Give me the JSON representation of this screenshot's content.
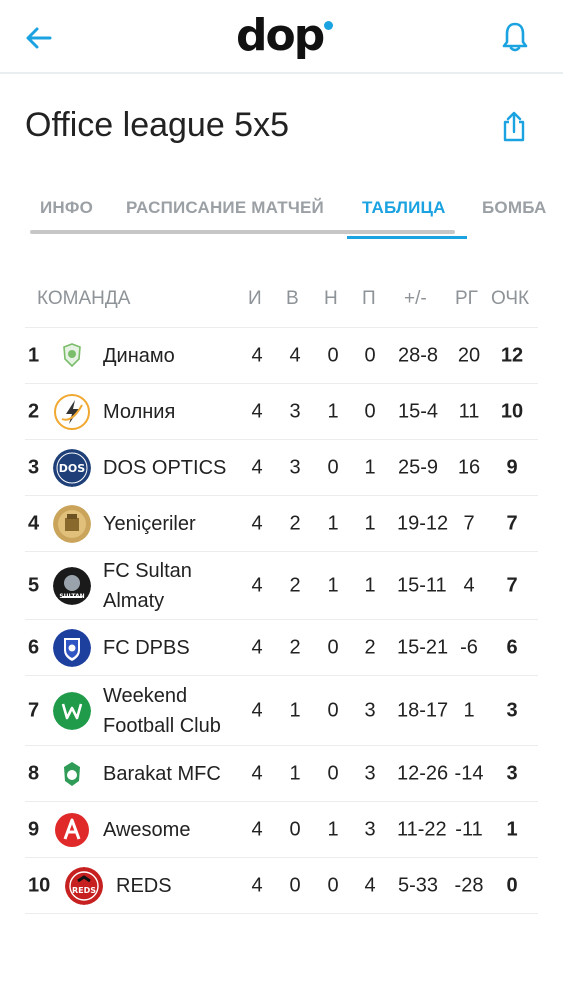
{
  "app": {
    "logo_text": "dop"
  },
  "page": {
    "title": "Office league 5x5"
  },
  "tabs": [
    {
      "label": "ИНФО",
      "active": false
    },
    {
      "label": "РАСПИСАНИЕ МАТЧЕЙ",
      "active": false
    },
    {
      "label": "ТАБЛИЦА",
      "active": true
    },
    {
      "label": "БОМБА",
      "active": false
    }
  ],
  "table": {
    "headers": {
      "team": "КОМАНДА",
      "played": "И",
      "won": "В",
      "draw": "Н",
      "lost": "П",
      "goals": "+/-",
      "diff": "РГ",
      "points": "ОЧК"
    },
    "rows": [
      {
        "pos": "1",
        "team": "Динамо",
        "played": "4",
        "won": "4",
        "draw": "0",
        "lost": "0",
        "goals": "28-8",
        "diff": "20",
        "points": "12",
        "logo_icon": "dinamo-crest-icon"
      },
      {
        "pos": "2",
        "team": "Молния",
        "played": "4",
        "won": "3",
        "draw": "1",
        "lost": "0",
        "goals": "15-4",
        "diff": "11",
        "points": "10",
        "logo_icon": "lightning-icon"
      },
      {
        "pos": "3",
        "team": "DOS OPTICS",
        "played": "4",
        "won": "3",
        "draw": "0",
        "lost": "1",
        "goals": "25-9",
        "diff": "16",
        "points": "9",
        "logo_icon": "dos-optics-icon"
      },
      {
        "pos": "4",
        "team": "Yeniçeriler",
        "played": "4",
        "won": "2",
        "draw": "1",
        "lost": "1",
        "goals": "19-12",
        "diff": "7",
        "points": "7",
        "logo_icon": "yeniceriler-icon"
      },
      {
        "pos": "5",
        "team": "FC Sultan Almaty",
        "played": "4",
        "won": "2",
        "draw": "1",
        "lost": "1",
        "goals": "15-11",
        "diff": "4",
        "points": "7",
        "logo_icon": "sultan-icon"
      },
      {
        "pos": "6",
        "team": "FC DPBS",
        "played": "4",
        "won": "2",
        "draw": "0",
        "lost": "2",
        "goals": "15-21",
        "diff": "-6",
        "points": "6",
        "logo_icon": "dpbs-shield-icon"
      },
      {
        "pos": "7",
        "team": "Weekend Football Club",
        "played": "4",
        "won": "1",
        "draw": "0",
        "lost": "3",
        "goals": "18-17",
        "diff": "1",
        "points": "3",
        "logo_icon": "weekend-fc-icon"
      },
      {
        "pos": "8",
        "team": "Barakat MFC",
        "played": "4",
        "won": "1",
        "draw": "0",
        "lost": "3",
        "goals": "12-26",
        "diff": "-14",
        "points": "3",
        "logo_icon": "barakat-icon"
      },
      {
        "pos": "9",
        "team": "Awesome",
        "played": "4",
        "won": "0",
        "draw": "1",
        "lost": "3",
        "goals": "11-22",
        "diff": "-11",
        "points": "1",
        "logo_icon": "awesome-icon"
      },
      {
        "pos": "10",
        "team": "REDS",
        "played": "4",
        "won": "0",
        "draw": "0",
        "lost": "4",
        "goals": "5-33",
        "diff": "-28",
        "points": "0",
        "logo_icon": "reds-icon"
      }
    ]
  },
  "colors": {
    "accent": "#1aa3e0",
    "muted": "#9ba0a5",
    "text": "#222222"
  }
}
